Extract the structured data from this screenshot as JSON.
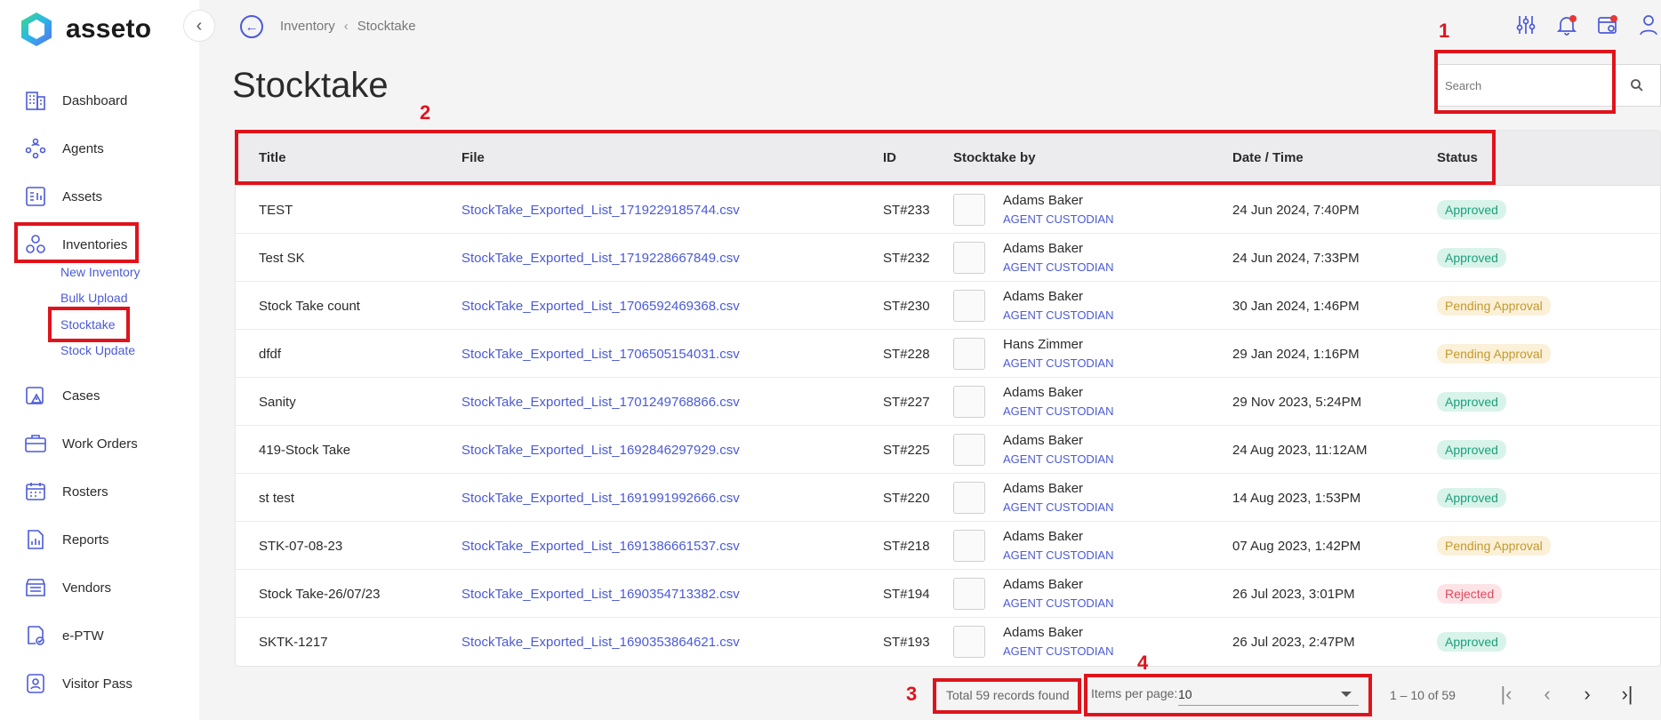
{
  "app": {
    "name": "asseto",
    "accent": "#4b5ad8"
  },
  "sidebar": {
    "items": [
      {
        "label": "Dashboard",
        "icon": "building-icon"
      },
      {
        "label": "Agents",
        "icon": "users-network-icon"
      },
      {
        "label": "Assets",
        "icon": "assets-icon"
      },
      {
        "label": "Inventories",
        "icon": "inventory-circles-icon"
      },
      {
        "label": "Cases",
        "icon": "case-warning-icon"
      },
      {
        "label": "Work Orders",
        "icon": "briefcase-icon"
      },
      {
        "label": "Rosters",
        "icon": "calendar-icon"
      },
      {
        "label": "Reports",
        "icon": "report-chart-icon"
      },
      {
        "label": "Vendors",
        "icon": "store-icon"
      },
      {
        "label": "e-PTW",
        "icon": "permit-icon"
      },
      {
        "label": "Visitor Pass",
        "icon": "badge-icon"
      }
    ],
    "subitems": [
      "New Inventory",
      "Bulk Upload",
      "Stocktake",
      "Stock Update"
    ]
  },
  "breadcrumb": {
    "parent": "Inventory",
    "current": "Stocktake"
  },
  "page": {
    "title": "Stocktake"
  },
  "search": {
    "placeholder": "Search"
  },
  "table": {
    "headers": {
      "title": "Title",
      "file": "File",
      "id": "ID",
      "by": "Stocktake by",
      "date": "Date / Time",
      "status": "Status"
    },
    "rows": [
      {
        "title": "TEST",
        "file": "StockTake_Exported_List_1719229185744.csv",
        "id": "ST#233",
        "name": "Adams Baker",
        "role": "AGENT CUSTODIAN",
        "date": "24 Jun 2024, 7:40PM",
        "status": "Approved"
      },
      {
        "title": "Test SK",
        "file": "StockTake_Exported_List_1719228667849.csv",
        "id": "ST#232",
        "name": "Adams Baker",
        "role": "AGENT CUSTODIAN",
        "date": "24 Jun 2024, 7:33PM",
        "status": "Approved"
      },
      {
        "title": "Stock Take count",
        "file": "StockTake_Exported_List_1706592469368.csv",
        "id": "ST#230",
        "name": "Adams Baker",
        "role": "AGENT CUSTODIAN",
        "date": "30 Jan 2024, 1:46PM",
        "status": "Pending Approval"
      },
      {
        "title": "dfdf",
        "file": "StockTake_Exported_List_1706505154031.csv",
        "id": "ST#228",
        "name": "Hans Zimmer",
        "role": "AGENT CUSTODIAN",
        "date": "29 Jan 2024, 1:16PM",
        "status": "Pending Approval"
      },
      {
        "title": "Sanity",
        "file": "StockTake_Exported_List_1701249768866.csv",
        "id": "ST#227",
        "name": "Adams Baker",
        "role": "AGENT CUSTODIAN",
        "date": "29 Nov 2023, 5:24PM",
        "status": "Approved"
      },
      {
        "title": "419-Stock Take",
        "file": "StockTake_Exported_List_1692846297929.csv",
        "id": "ST#225",
        "name": "Adams Baker",
        "role": "AGENT CUSTODIAN",
        "date": "24 Aug 2023, 11:12AM",
        "status": "Approved"
      },
      {
        "title": "st test",
        "file": "StockTake_Exported_List_1691991992666.csv",
        "id": "ST#220",
        "name": "Adams Baker",
        "role": "AGENT CUSTODIAN",
        "date": "14 Aug 2023, 1:53PM",
        "status": "Approved"
      },
      {
        "title": "STK-07-08-23",
        "file": "StockTake_Exported_List_1691386661537.csv",
        "id": "ST#218",
        "name": "Adams Baker",
        "role": "AGENT CUSTODIAN",
        "date": "07 Aug 2023, 1:42PM",
        "status": "Pending Approval"
      },
      {
        "title": "Stock Take-26/07/23",
        "file": "StockTake_Exported_List_1690354713382.csv",
        "id": "ST#194",
        "name": "Adams Baker",
        "role": "AGENT CUSTODIAN",
        "date": "26 Jul 2023, 3:01PM",
        "status": "Rejected"
      },
      {
        "title": "SKTK-1217",
        "file": "StockTake_Exported_List_1690353864621.csv",
        "id": "ST#193",
        "name": "Adams Baker",
        "role": "AGENT CUSTODIAN",
        "date": "26 Jul 2023, 2:47PM",
        "status": "Approved"
      }
    ]
  },
  "pagination": {
    "total_text": "Total 59 records found",
    "items_per_page_label": "Items per page:",
    "items_per_page": "10",
    "range": "1 – 10 of 59"
  },
  "annotations": [
    "1",
    "2",
    "3",
    "4"
  ],
  "status_colors": {
    "Approved": "#1aa07a",
    "Pending Approval": "#c49a2c",
    "Rejected": "#e0495e"
  }
}
